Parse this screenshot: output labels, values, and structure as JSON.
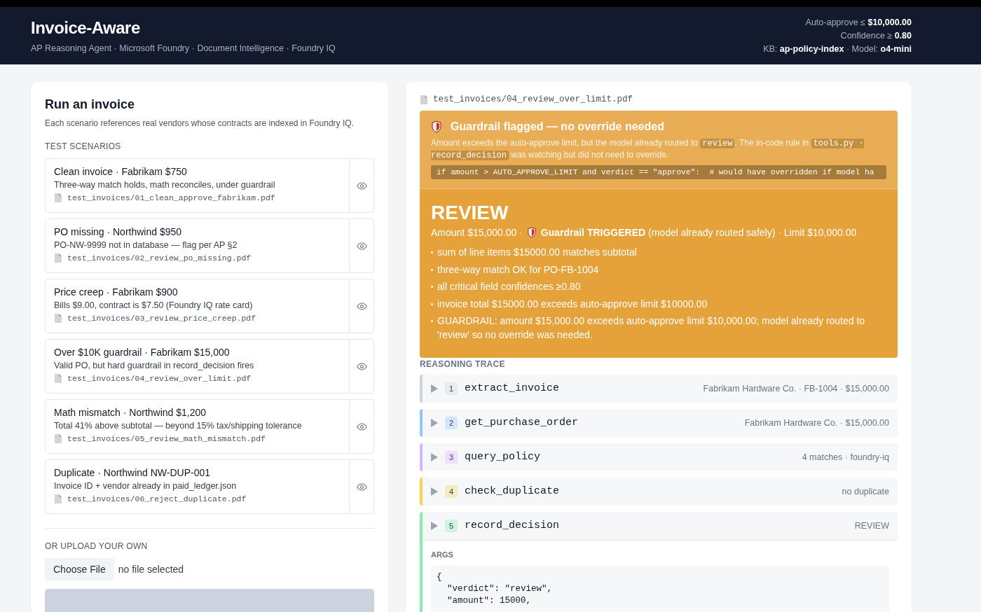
{
  "header": {
    "title": "Invoice-Aware",
    "subtitle": "AP Reasoning Agent · Microsoft Foundry · Document Intelligence · Foundry IQ",
    "settings": [
      "Auto-approve ≤ **$10,000.00**",
      "Confidence ≥ **0.80**",
      "KB: **ap-policy-index** · Model: **o4-mini**"
    ]
  },
  "run_panel": {
    "title": "Run an invoice",
    "description": "Each scenario references real vendors whose contracts are indexed in Foundry IQ.",
    "scenarios_heading": "TEST SCENARIOS",
    "scenarios": [
      {
        "title": "Clean invoice · Fabrikam $750",
        "description": "Three-way match holds, math reconciles, under guardrail",
        "file": "test_invoices/01_clean_approve_fabrikam.pdf"
      },
      {
        "title": "PO missing · Northwind $950",
        "description": "PO-NW-9999 not in database — flag per AP §2",
        "file": "test_invoices/02_review_po_missing.pdf"
      },
      {
        "title": "Price creep · Fabrikam $900",
        "description": "Bills $9.00, contract is $7.50 (Foundry IQ rate card)",
        "file": "test_invoices/03_review_price_creep.pdf"
      },
      {
        "title": "Over $10K guardrail · Fabrikam $15,000",
        "description": "Valid PO, but hard guardrail in record_decision fires",
        "file": "test_invoices/04_review_over_limit.pdf"
      },
      {
        "title": "Math mismatch · Northwind $1,200",
        "description": "Total 41% above subtotal — beyond 15% tax/shipping tolerance",
        "file": "test_invoices/05_review_math_mismatch.pdf"
      },
      {
        "title": "Duplicate · Northwind NW-DUP-001",
        "description": "Invoice ID + vendor already in paid_ledger.json",
        "file": "test_invoices/06_reject_duplicate.pdf"
      }
    ],
    "upload_heading": "OR UPLOAD YOUR OWN",
    "choose_file": "Choose File",
    "file_status": "no file selected",
    "upload_disabled": true
  },
  "result": {
    "file": "test_invoices/04_review_over_limit.pdf",
    "banner": {
      "title": "Guardrail flagged — no override needed",
      "message": [
        {
          "kind": "text",
          "text": "Amount exceeds the auto-approve limit, but the model already routed to "
        },
        {
          "kind": "code",
          "text": "review"
        },
        {
          "kind": "text",
          "text": ". The in-code rule in "
        },
        {
          "kind": "code",
          "text": "tools.py · record_decision"
        },
        {
          "kind": "text",
          "text": " was watching but did not need to override."
        }
      ],
      "code": "if amount > AUTO_APPROVE_LIMIT and verdict == \"approve\":  # would have overridden if model ha"
    },
    "verdict": {
      "label": "REVIEW",
      "summary_start": "Amount $15,000.00 ·",
      "summary_end": "**Guardrail TRIGGERED** (model already routed safely) · Limit $10,000.00",
      "reasons": [
        "sum of line items $15000.00 matches subtotal",
        "three-way match OK for PO-FB-1004",
        "all critical field confidences ≥0.80",
        "invoice total $15000.00 exceeds auto-approve limit $10000.00",
        "GUARDRAIL: amount $15,000.00 exceeds auto-approve limit $10,000.00; model already routed to 'review' so no override was needed."
      ]
    },
    "trace_heading": "REASONING TRACE",
    "trace": [
      {
        "number": "1",
        "tool": "extract_invoice",
        "summary": "Fabrikam Hardware Co. · FB-1004 · $15,000.00",
        "color": "#cbd5e1",
        "expanded": false
      },
      {
        "number": "2",
        "tool": "get_purchase_order",
        "summary": "Fabrikam Hardware Co. · $15,000.00",
        "color": "#93c5fd",
        "expanded": false
      },
      {
        "number": "3",
        "tool": "query_policy",
        "summary": "4 matches · foundry-iq",
        "color": "#d8b4fe",
        "expanded": false
      },
      {
        "number": "4",
        "tool": "check_duplicate",
        "summary": "no duplicate",
        "color": "#fcd34d",
        "expanded": false
      },
      {
        "number": "5",
        "tool": "record_decision",
        "summary": "REVIEW",
        "color": "#86efac",
        "expanded": true,
        "args_label": "ARGS",
        "args": "{\n  \"verdict\": \"review\",\n  \"amount\": 15000,"
      }
    ]
  }
}
